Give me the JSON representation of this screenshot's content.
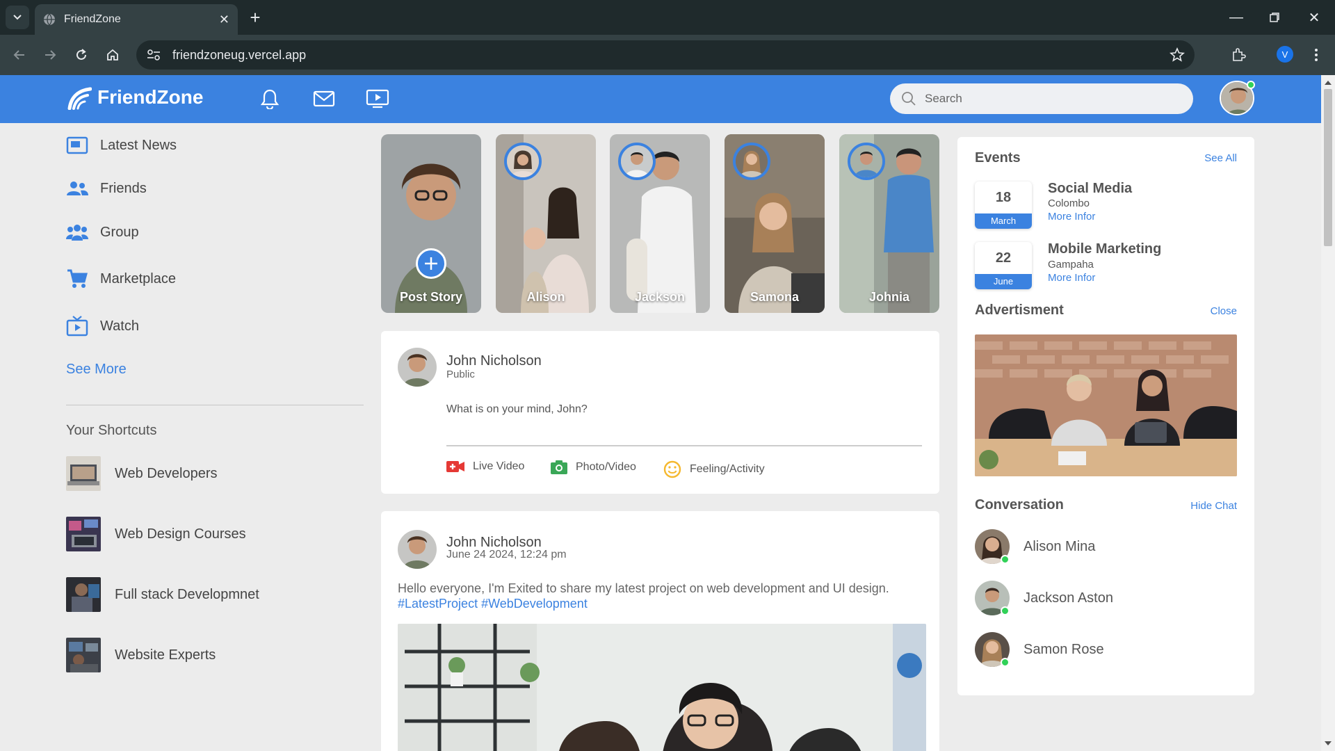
{
  "browser": {
    "tab_title": "FriendZone",
    "url": "friendzoneug.vercel.app",
    "profile_initial": "V"
  },
  "header": {
    "brand": "FriendZone",
    "search_placeholder": "Search"
  },
  "sidebar": {
    "items": [
      {
        "label": "Latest News",
        "icon": "newspaper-icon"
      },
      {
        "label": "Friends",
        "icon": "friends-icon"
      },
      {
        "label": "Group",
        "icon": "group-icon"
      },
      {
        "label": "Marketplace",
        "icon": "cart-icon"
      },
      {
        "label": "Watch",
        "icon": "tv-icon"
      }
    ],
    "see_more": "See More",
    "shortcuts_title": "Your Shortcuts",
    "shortcuts": [
      {
        "label": "Web Developers"
      },
      {
        "label": "Web Design Courses"
      },
      {
        "label": "Full stack Developmnet"
      },
      {
        "label": "Website Experts"
      }
    ]
  },
  "stories": [
    {
      "name": "Post Story"
    },
    {
      "name": "Alison"
    },
    {
      "name": "Jackson"
    },
    {
      "name": "Samona"
    },
    {
      "name": "Johnia"
    }
  ],
  "composer": {
    "name": "John Nicholson",
    "visibility": "Public",
    "prompt": "What is on your mind, John?",
    "actions": [
      {
        "label": "Live Video",
        "icon": "live-video-icon"
      },
      {
        "label": "Photo/Video",
        "icon": "camera-icon"
      },
      {
        "label": "Feeling/Activity",
        "icon": "smiley-icon"
      }
    ]
  },
  "post": {
    "name": "John Nicholson",
    "timestamp": "June 24 2024, 12:24 pm",
    "text": "Hello everyone, I'm Exited to share my latest project on web development and UI design.",
    "hashtags": "#LatestProject #WebDevelopment"
  },
  "events": {
    "title": "Events",
    "see_all": "See All",
    "items": [
      {
        "day": "18",
        "month": "March",
        "title": "Social Media",
        "location": "Colombo",
        "more": "More Infor"
      },
      {
        "day": "22",
        "month": "June",
        "title": "Mobile Marketing",
        "location": "Gampaha",
        "more": "More Infor"
      }
    ]
  },
  "advertisement": {
    "title": "Advertisment",
    "close": "Close"
  },
  "conversation": {
    "title": "Conversation",
    "hide": "Hide Chat",
    "people": [
      {
        "name": "Alison Mina"
      },
      {
        "name": "Jackson Aston"
      },
      {
        "name": "Samon Rose"
      }
    ]
  },
  "colors": {
    "brand": "#3b82e0",
    "online": "#31d158",
    "live": "#e53935",
    "photo": "#3aa757",
    "feeling": "#f5b82e"
  }
}
